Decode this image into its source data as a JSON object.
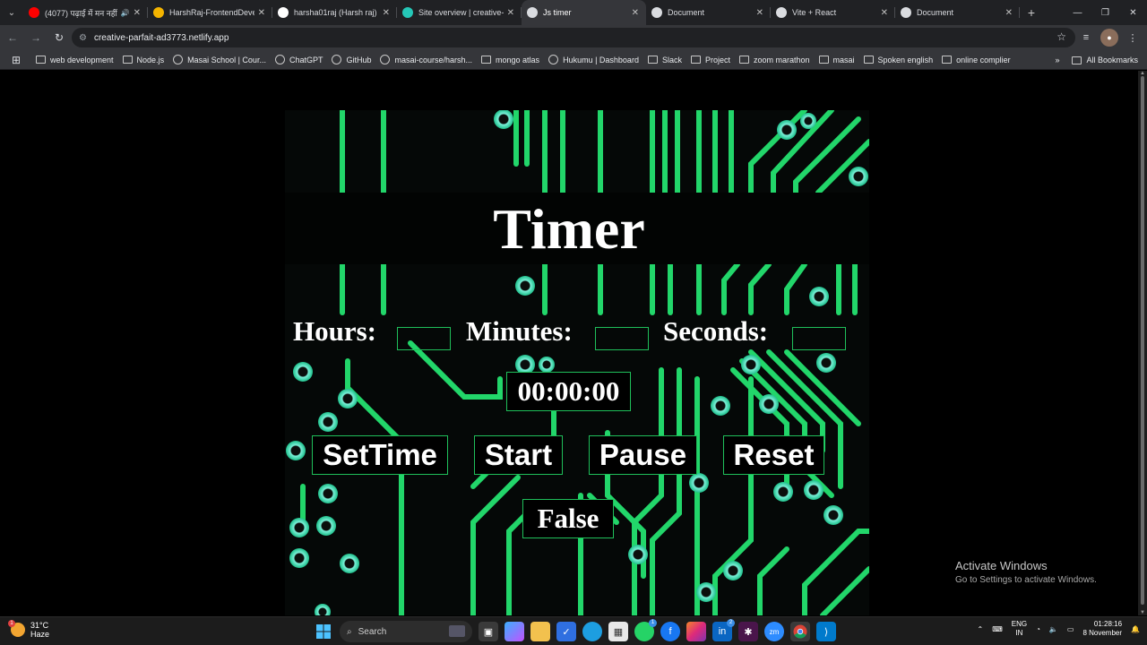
{
  "browser": {
    "tabs": [
      {
        "title": "(4077) पढ़ाई में मन नहीं",
        "icon": "youtube-icon",
        "color": "#ff0000",
        "audio": true
      },
      {
        "title": "HarshRaj-FrontendDevelo",
        "icon": "drive-icon",
        "color": "#f4b400"
      },
      {
        "title": "harsha01raj (Harsh raj)",
        "icon": "github-icon",
        "color": "#ffffff"
      },
      {
        "title": "Site overview | creative-pa",
        "icon": "netlify-icon",
        "color": "#25c7b7"
      },
      {
        "title": "Js timer",
        "icon": "globe-icon",
        "color": "#dadce0",
        "active": true
      },
      {
        "title": "Document",
        "icon": "globe-icon",
        "color": "#dadce0"
      },
      {
        "title": "Vite + React",
        "icon": "globe-icon",
        "color": "#dadce0"
      },
      {
        "title": "Document",
        "icon": "globe-icon",
        "color": "#dadce0"
      }
    ],
    "url": "creative-parfait-ad3773.netlify.app",
    "bookmarks": [
      {
        "label": "web development",
        "icon": "folder-icon"
      },
      {
        "label": "Node.js",
        "icon": "folder-icon"
      },
      {
        "label": "Masai School | Cour...",
        "icon": "masai-icon"
      },
      {
        "label": "ChatGPT",
        "icon": "chatgpt-icon"
      },
      {
        "label": "GitHub",
        "icon": "github-icon"
      },
      {
        "label": "masai-course/harsh...",
        "icon": "github-icon"
      },
      {
        "label": "mongo atlas",
        "icon": "folder-icon"
      },
      {
        "label": "Hukumu | Dashboard",
        "icon": "hukumu-icon"
      },
      {
        "label": "Slack",
        "icon": "folder-icon"
      },
      {
        "label": "Project",
        "icon": "folder-icon"
      },
      {
        "label": "zoom marathon",
        "icon": "folder-icon"
      },
      {
        "label": "masai",
        "icon": "folder-icon"
      },
      {
        "label": "Spoken english",
        "icon": "folder-icon"
      },
      {
        "label": "online complier",
        "icon": "folder-icon"
      }
    ],
    "all_bookmarks": "All Bookmarks",
    "overflow": "»"
  },
  "page": {
    "title": "Timer",
    "hours_label": "Hours:",
    "minutes_label": "Minutes:",
    "seconds_label": "Seconds:",
    "hours_value": "",
    "minutes_value": "",
    "seconds_value": "",
    "display": "00:00:00",
    "buttons": {
      "settime": "SetTime",
      "start": "Start",
      "pause": "Pause",
      "reset": "Reset"
    },
    "status": "False",
    "accent_color": "#1fbf5a"
  },
  "watermark": {
    "heading": "Activate Windows",
    "sub": "Go to Settings to activate Windows."
  },
  "taskbar": {
    "temperature": "31°C",
    "weather": "Haze",
    "search_placeholder": "Search",
    "lang_top": "ENG",
    "lang_bottom": "IN",
    "time": "01:28:16",
    "date": "8 November"
  }
}
